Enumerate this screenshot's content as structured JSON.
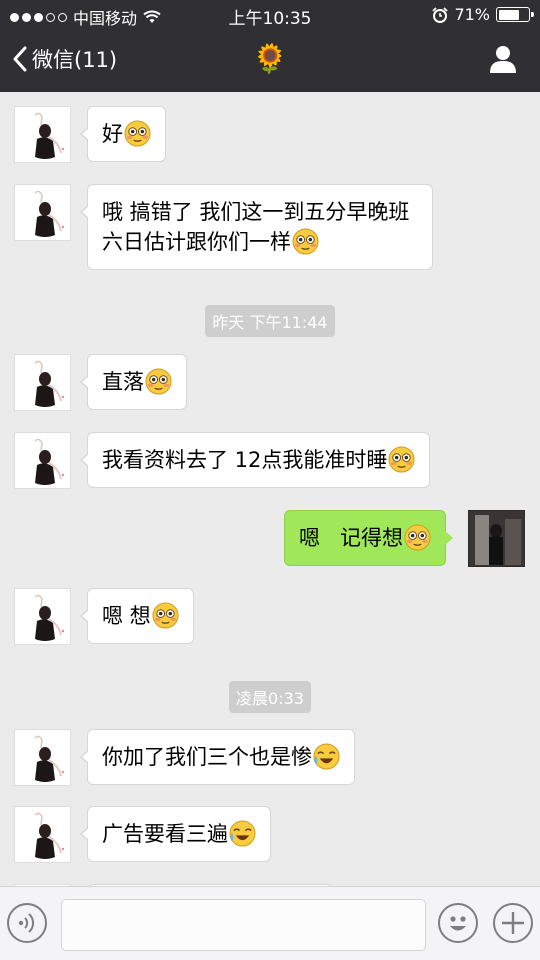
{
  "status_bar": {
    "carrier": "中国移动",
    "time": "上午10:35",
    "battery": "71%",
    "battery_level": 0.71
  },
  "nav": {
    "back_label": "微信(11)",
    "title": "🌻"
  },
  "messages": [
    {
      "side": "left",
      "text": "好",
      "emoji": "flushed-emoji"
    },
    {
      "side": "left",
      "text": "哦 搞错了 我们这一到五分早晚班 六日估计跟你们一样",
      "emoji": "flushed-emoji"
    },
    {
      "type": "time",
      "text": "昨天 下午11:44"
    },
    {
      "side": "left",
      "text": "直落",
      "emoji": "flushed-emoji"
    },
    {
      "side": "left",
      "text": "我看资料去了 12点我能准时睡",
      "emoji": "flushed-emoji"
    },
    {
      "side": "right",
      "text": "嗯   记得想",
      "emoji": "flushed-emoji"
    },
    {
      "side": "left",
      "text": "嗯 想",
      "emoji": "flushed-emoji"
    },
    {
      "type": "time",
      "text": "凌晨0:33"
    },
    {
      "side": "left",
      "text": "你加了我们三个也是惨",
      "emoji": "laugh-cry-emoji"
    },
    {
      "side": "left",
      "text": "广告要看三遍",
      "emoji": "laugh-cry-emoji"
    }
  ],
  "input": {
    "placeholder": ""
  },
  "colors": {
    "nav_bg": "#303034",
    "chat_bg": "#ebebeb",
    "right_bubble": "#a0e75a",
    "left_bubble": "#ffffff"
  }
}
